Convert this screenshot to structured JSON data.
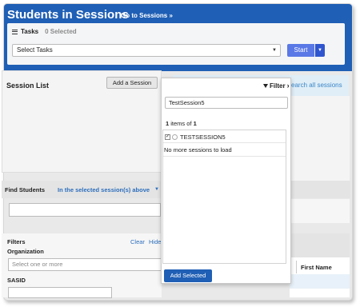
{
  "header": {
    "title": "Students in Sessions",
    "goto_label": "Go to Sessions »"
  },
  "tasks": {
    "label": "Tasks",
    "selected_count": "0 Selected",
    "select_value": "Select Tasks",
    "start_label": "Start"
  },
  "session_list": {
    "title": "Session List",
    "add_button": "Add a Session",
    "search_all_link": "search all sessions"
  },
  "dropdown": {
    "filter_label": "Filter",
    "search_value": "TestSession5",
    "count_prefix": "items of",
    "count_shown": "1",
    "count_total": "1",
    "items": [
      {
        "name": "TESTSESSION5",
        "checked": true
      }
    ],
    "no_more": "No more sessions to load",
    "add_selected": "Add Selected"
  },
  "find_students": {
    "label": "Find Students",
    "scope": "In the selected session(s) above"
  },
  "filters": {
    "label": "Filters",
    "clear": "Clear",
    "hide": "Hide",
    "org_label": "Organization",
    "org_placeholder": "Select one or more",
    "sasid_label": "SASID"
  },
  "table": {
    "first_name_header": "First Name"
  },
  "colors": {
    "brand": "#1f5fb5",
    "start_button": "#5a78e6",
    "link": "#2d6fbd"
  }
}
